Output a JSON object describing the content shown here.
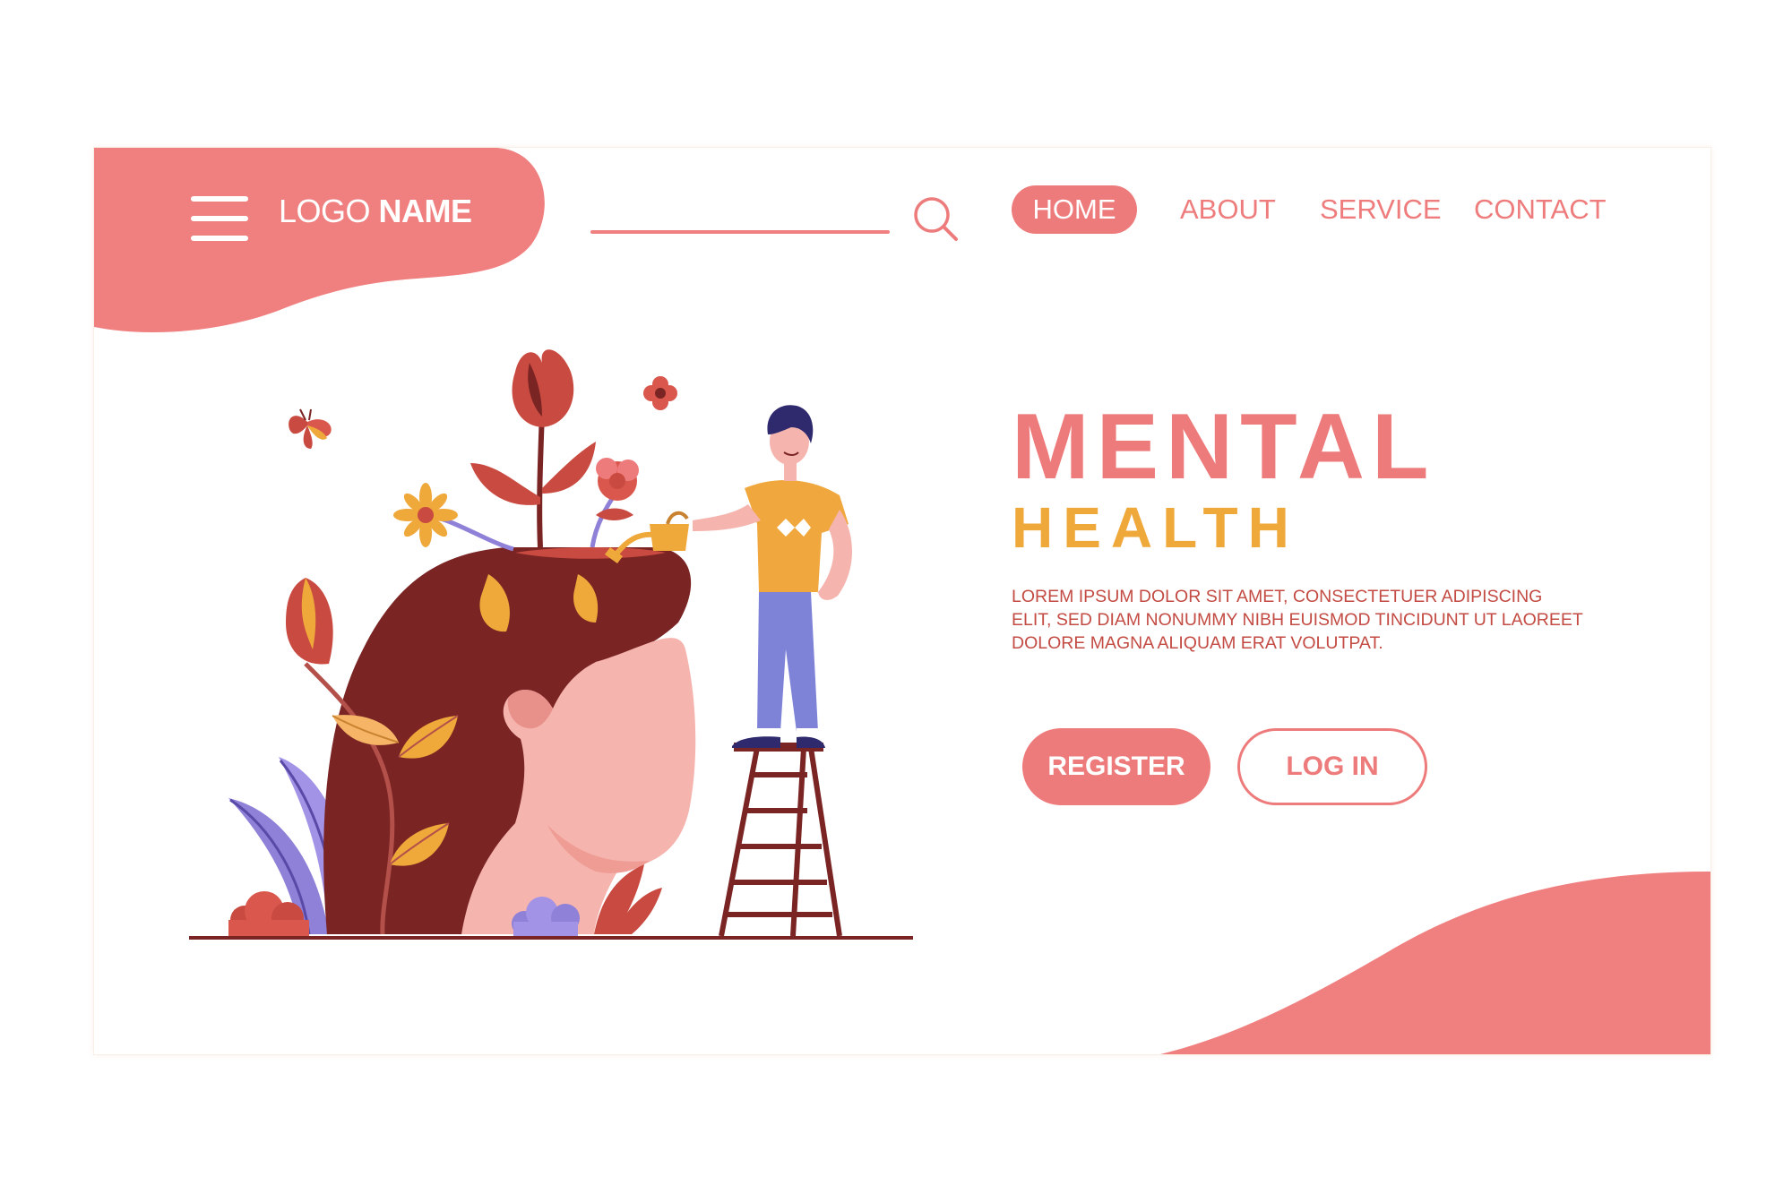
{
  "header": {
    "logo_regular": "LOGO",
    "logo_bold": "NAME",
    "search_placeholder": "",
    "nav": [
      {
        "label": "HOME",
        "active": true
      },
      {
        "label": "ABOUT",
        "active": false
      },
      {
        "label": "SERVICE",
        "active": false
      },
      {
        "label": "CONTACT",
        "active": false
      }
    ]
  },
  "hero": {
    "title": "MENTAL",
    "subtitle": "HEALTH",
    "description": "LOREM IPSUM DOLOR SIT AMET, CONSECTETUER ADIPISCING ELIT, SED DIAM NONUMMY NIBH EUISMOD TINCIDUNT UT LAOREET DOLORE MAGNA ALIQUAM ERAT VOLUTPAT.",
    "register_label": "REGISTER",
    "login_label": "LOG IN"
  },
  "colors": {
    "primary": "#ee7b7b",
    "accent": "#efa83a",
    "text": "#c34b43",
    "hair": "#7a2424",
    "skin": "#f6b4ae",
    "purple": "#8f80d8"
  },
  "icons": {
    "menu": "hamburger-menu-icon",
    "search": "search-icon"
  }
}
